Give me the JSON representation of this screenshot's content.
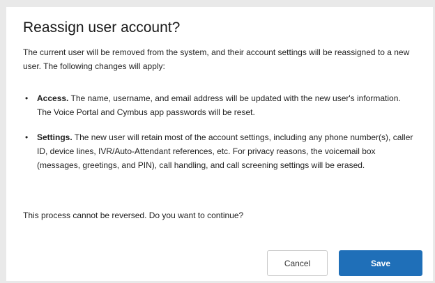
{
  "dialog": {
    "title": "Reassign user account?",
    "intro": "The current user will be removed from the system, and their account settings will be reassigned to a new user. The following changes will apply:",
    "bullets": [
      {
        "marker": "•",
        "heading": "Access.",
        "text": " The name, username, and email address will be updated with the new user's information. The Voice Portal and Cymbus app passwords will be reset."
      },
      {
        "marker": "•",
        "heading": "Settings.",
        "text": " The new user will retain most of the account settings, including any phone number(s), caller ID, device lines, IVR/Auto-Attendant references, etc. For privacy reasons, the voicemail box (messages, greetings, and PIN), call handling, and call screening settings will be erased."
      }
    ],
    "question": "This process cannot be reversed. Do you want to continue?",
    "cancel_label": "Cancel",
    "save_label": "Save"
  },
  "colors": {
    "primary": "#1f6fb8",
    "background": "#e9e9e9"
  }
}
